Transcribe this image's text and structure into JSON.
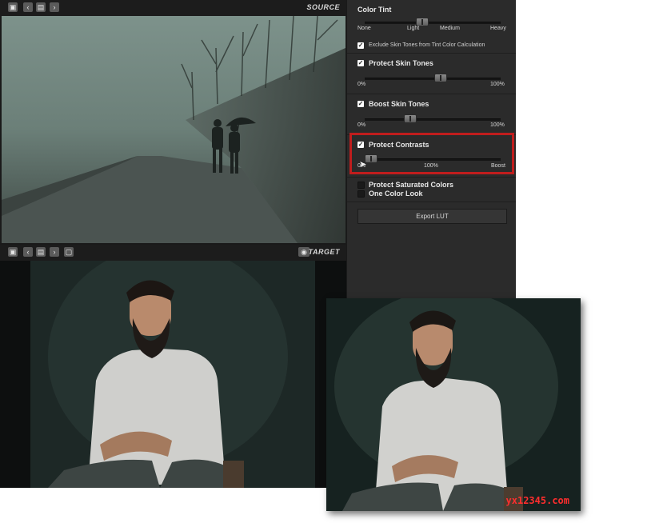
{
  "source": {
    "label": "SOURCE",
    "toolbar_icons": [
      "save-icon",
      "chevron-left-icon",
      "folder-icon",
      "chevron-right-icon"
    ]
  },
  "target": {
    "label": "TARGET",
    "toolbar_icons": [
      "save-icon",
      "chevron-left-icon",
      "folder-icon",
      "chevron-right-icon",
      "export-icon",
      "eye-icon"
    ]
  },
  "color_tint": {
    "title": "Color Tint",
    "ticks": [
      "None",
      "Light",
      "Medium",
      "Heavy"
    ],
    "value_fraction": 0.42,
    "exclude_label": "Exclude Skin Tones from Tint Color Calculation",
    "exclude_checked": true
  },
  "protect_skin": {
    "title": "Protect Skin Tones",
    "checked": true,
    "min": "0%",
    "max": "100%",
    "value_fraction": 0.55
  },
  "boost_skin": {
    "title": "Boost Skin Tones",
    "checked": true,
    "min": "0%",
    "max": "100%",
    "value_fraction": 0.33
  },
  "protect_contrasts": {
    "title": "Protect Contrasts",
    "checked": true,
    "min": "0%",
    "mid": "100%",
    "max": "Boost",
    "value_fraction": 0.04
  },
  "protect_saturated": {
    "title": "Protect Saturated Colors",
    "checked": false
  },
  "one_color": {
    "title": "One Color Look",
    "checked": false
  },
  "export_label": "Export LUT",
  "watermark": "yx12345.com",
  "colors": {
    "highlight": "#c01d1d",
    "panel": "#2b2b2b",
    "watermark": "#ff2e2e"
  }
}
